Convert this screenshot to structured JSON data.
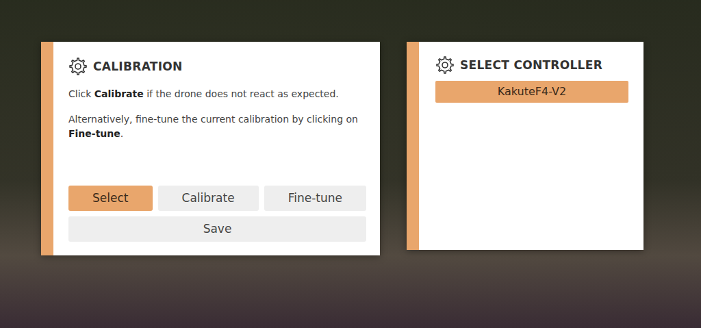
{
  "calibration": {
    "title": "CALIBRATION",
    "paragraphs": [
      [
        {
          "text": "Click ",
          "bold": false
        },
        {
          "text": "Calibrate",
          "bold": true
        },
        {
          "text": " if the drone does not react as expected.",
          "bold": false
        }
      ],
      [
        {
          "text": "Alternatively, fine-tune the current calibration by clicking on ",
          "bold": false
        },
        {
          "text": "Fine-tune",
          "bold": true
        },
        {
          "text": ".",
          "bold": false
        }
      ]
    ],
    "buttons": [
      {
        "label": "Select",
        "selected": true
      },
      {
        "label": "Calibrate",
        "selected": false
      },
      {
        "label": "Fine-tune",
        "selected": false
      }
    ],
    "save_button": "Save"
  },
  "controller_panel": {
    "title": "SELECT CONTROLLER",
    "controllers": [
      {
        "name": "KakuteF4-V2",
        "selected": true
      }
    ]
  }
}
